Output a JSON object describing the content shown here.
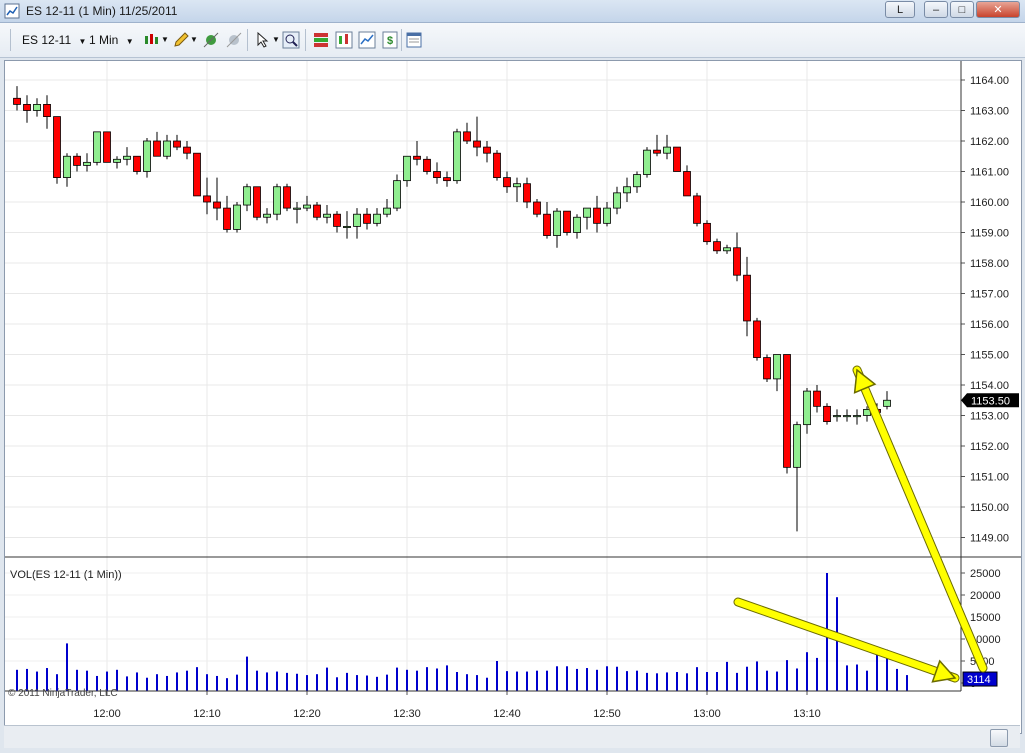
{
  "window": {
    "title": "ES 12-11 (1 Min)  11/25/2011",
    "link_button_label": "L",
    "minimize_label": "–",
    "maximize_label": "□",
    "close_label": "✕"
  },
  "toolbar": {
    "instrument": "ES 12-11",
    "interval": "1 Min",
    "icons": [
      "bar-style-icon",
      "pencil-icon",
      "indicator-icon",
      "strategy-icon",
      "cursor-icon",
      "zoom-icon",
      "chart-trader-icon",
      "candles-icon",
      "chart-properties-icon",
      "dollar-icon",
      "data-box-icon"
    ]
  },
  "chart_data": [
    {
      "type": "candlestick",
      "panel": "price",
      "x_ticks": [
        "12:00",
        "12:10",
        "12:20",
        "12:30",
        "12:40",
        "12:50",
        "13:00",
        "13:10"
      ],
      "y_ticks": [
        "1164.00",
        "1163.00",
        "1162.00",
        "1161.00",
        "1160.00",
        "1159.00",
        "1158.00",
        "1157.00",
        "1156.00",
        "1155.00",
        "1154.00",
        "1153.00",
        "1152.00",
        "1151.00",
        "1150.00",
        "1149.00"
      ],
      "ylim": [
        1148.5,
        1164.5
      ],
      "last_price_label": "1153.50",
      "up_color": "#90ee90",
      "down_color": "#ff0000",
      "candles": [
        [
          1163.4,
          1163.8,
          1163.0,
          1163.2
        ],
        [
          1163.2,
          1163.5,
          1162.6,
          1163.0
        ],
        [
          1163.0,
          1163.4,
          1162.8,
          1163.2
        ],
        [
          1163.2,
          1163.5,
          1162.4,
          1162.8
        ],
        [
          1162.8,
          1162.8,
          1160.6,
          1160.8
        ],
        [
          1160.8,
          1161.6,
          1160.5,
          1161.5
        ],
        [
          1161.5,
          1161.6,
          1161.0,
          1161.2
        ],
        [
          1161.2,
          1161.6,
          1161.0,
          1161.3
        ],
        [
          1161.3,
          1162.3,
          1161.2,
          1162.3
        ],
        [
          1162.3,
          1162.3,
          1161.3,
          1161.3
        ],
        [
          1161.3,
          1161.5,
          1161.1,
          1161.4
        ],
        [
          1161.4,
          1161.8,
          1161.2,
          1161.5
        ],
        [
          1161.5,
          1161.5,
          1160.9,
          1161.0
        ],
        [
          1161.0,
          1162.1,
          1160.8,
          1162.0
        ],
        [
          1162.0,
          1162.3,
          1161.5,
          1161.5
        ],
        [
          1161.5,
          1162.2,
          1161.4,
          1162.0
        ],
        [
          1162.0,
          1162.2,
          1161.7,
          1161.8
        ],
        [
          1161.8,
          1162.0,
          1161.4,
          1161.6
        ],
        [
          1161.6,
          1161.6,
          1160.2,
          1160.2
        ],
        [
          1160.2,
          1160.8,
          1159.6,
          1160.0
        ],
        [
          1160.0,
          1160.8,
          1159.4,
          1159.8
        ],
        [
          1159.8,
          1160.2,
          1159.0,
          1159.1
        ],
        [
          1159.1,
          1160.0,
          1159.0,
          1159.9
        ],
        [
          1159.9,
          1160.6,
          1159.7,
          1160.5
        ],
        [
          1160.5,
          1160.5,
          1159.4,
          1159.5
        ],
        [
          1159.5,
          1159.8,
          1159.3,
          1159.6
        ],
        [
          1159.6,
          1160.6,
          1159.4,
          1160.5
        ],
        [
          1160.5,
          1160.6,
          1159.7,
          1159.8
        ],
        [
          1159.8,
          1160.0,
          1159.3,
          1159.8
        ],
        [
          1159.8,
          1160.2,
          1159.7,
          1159.9
        ],
        [
          1159.9,
          1160.0,
          1159.4,
          1159.5
        ],
        [
          1159.5,
          1159.9,
          1159.3,
          1159.6
        ],
        [
          1159.6,
          1159.7,
          1159.0,
          1159.2
        ],
        [
          1159.2,
          1159.7,
          1158.8,
          1159.2
        ],
        [
          1159.2,
          1159.8,
          1158.8,
          1159.6
        ],
        [
          1159.6,
          1159.8,
          1159.1,
          1159.3
        ],
        [
          1159.3,
          1159.8,
          1159.2,
          1159.6
        ],
        [
          1159.6,
          1160.1,
          1159.5,
          1159.8
        ],
        [
          1159.8,
          1160.9,
          1159.7,
          1160.7
        ],
        [
          1160.7,
          1161.5,
          1160.5,
          1161.5
        ],
        [
          1161.5,
          1162.0,
          1161.2,
          1161.4
        ],
        [
          1161.4,
          1161.5,
          1160.9,
          1161.0
        ],
        [
          1161.0,
          1161.3,
          1160.6,
          1160.8
        ],
        [
          1160.8,
          1161.0,
          1160.5,
          1160.7
        ],
        [
          1160.7,
          1162.4,
          1160.6,
          1162.3
        ],
        [
          1162.3,
          1162.6,
          1161.9,
          1162.0
        ],
        [
          1162.0,
          1162.8,
          1161.5,
          1161.8
        ],
        [
          1161.8,
          1162.0,
          1161.3,
          1161.6
        ],
        [
          1161.6,
          1161.7,
          1160.7,
          1160.8
        ],
        [
          1160.8,
          1161.0,
          1160.3,
          1160.5
        ],
        [
          1160.5,
          1160.8,
          1160.0,
          1160.6
        ],
        [
          1160.6,
          1160.8,
          1159.8,
          1160.0
        ],
        [
          1160.0,
          1160.1,
          1159.5,
          1159.6
        ],
        [
          1159.6,
          1160.0,
          1158.8,
          1158.9
        ],
        [
          1158.9,
          1159.8,
          1158.5,
          1159.7
        ],
        [
          1159.7,
          1159.7,
          1158.9,
          1159.0
        ],
        [
          1159.0,
          1159.6,
          1158.8,
          1159.5
        ],
        [
          1159.5,
          1159.8,
          1159.1,
          1159.8
        ],
        [
          1159.8,
          1160.2,
          1159.0,
          1159.3
        ],
        [
          1159.3,
          1160.0,
          1159.2,
          1159.8
        ],
        [
          1159.8,
          1160.5,
          1159.6,
          1160.3
        ],
        [
          1160.3,
          1160.8,
          1160.0,
          1160.5
        ],
        [
          1160.5,
          1161.0,
          1160.3,
          1160.9
        ],
        [
          1160.9,
          1161.8,
          1160.8,
          1161.7
        ],
        [
          1161.7,
          1162.2,
          1161.5,
          1161.6
        ],
        [
          1161.6,
          1162.2,
          1161.4,
          1161.8
        ],
        [
          1161.8,
          1161.8,
          1161.0,
          1161.0
        ],
        [
          1161.0,
          1161.2,
          1160.2,
          1160.2
        ],
        [
          1160.2,
          1160.3,
          1159.2,
          1159.3
        ],
        [
          1159.3,
          1159.4,
          1158.6,
          1158.7
        ],
        [
          1158.7,
          1158.8,
          1158.3,
          1158.4
        ],
        [
          1158.4,
          1158.6,
          1158.3,
          1158.5
        ],
        [
          1158.5,
          1159.0,
          1157.4,
          1157.6
        ],
        [
          1157.6,
          1158.2,
          1155.6,
          1156.1
        ],
        [
          1156.1,
          1156.2,
          1154.8,
          1154.9
        ],
        [
          1154.9,
          1155.0,
          1154.1,
          1154.2
        ],
        [
          1154.2,
          1155.0,
          1153.8,
          1155.0
        ],
        [
          1155.0,
          1155.0,
          1151.1,
          1151.3
        ],
        [
          1151.3,
          1152.8,
          1149.2,
          1152.7
        ],
        [
          1152.7,
          1153.9,
          1152.4,
          1153.8
        ],
        [
          1153.8,
          1154.0,
          1153.1,
          1153.3
        ],
        [
          1153.3,
          1153.4,
          1152.7,
          1152.8
        ],
        [
          1153.0,
          1153.2,
          1152.8,
          1153.0
        ],
        [
          1153.0,
          1153.2,
          1152.8,
          1153.0
        ],
        [
          1153.0,
          1153.2,
          1152.7,
          1153.0
        ],
        [
          1153.0,
          1153.3,
          1152.8,
          1153.2
        ],
        [
          1153.2,
          1153.4,
          1152.9,
          1153.1
        ],
        [
          1153.3,
          1153.8,
          1153.2,
          1153.5
        ]
      ]
    },
    {
      "type": "bar",
      "panel": "volume",
      "label": "VOL(ES 12-11 (1 Min))",
      "y_ticks": [
        "25000",
        "20000",
        "15000",
        "10000",
        "5000",
        "0"
      ],
      "ylim": [
        0,
        26000
      ],
      "last_value_label": "3114",
      "color": "#0000cd",
      "values": [
        3000,
        3200,
        2600,
        3400,
        2000,
        9000,
        3000,
        2800,
        1600,
        2600,
        3000,
        1500,
        2400,
        1200,
        2000,
        1600,
        2400,
        2800,
        3600,
        2000,
        1600,
        1100,
        1900,
        6000,
        2800,
        2400,
        2600,
        2300,
        2100,
        1800,
        2000,
        3500,
        1300,
        2300,
        1800,
        1700,
        1400,
        1900,
        3500,
        3000,
        2800,
        3600,
        3300,
        4000,
        2500,
        2000,
        1800,
        1200,
        5000,
        2700,
        2600,
        2600,
        2800,
        2800,
        3800,
        3800,
        3200,
        3400,
        3000,
        3800,
        3700,
        2700,
        2800,
        2300,
        2200,
        2400,
        2500,
        2200,
        3600,
        2500,
        2500,
        4800,
        2300,
        3700,
        4900,
        2800,
        2600,
        5200,
        3300,
        7000,
        5700,
        25000,
        19500,
        4000,
        4200,
        2800,
        6500,
        7600,
        3200,
        1800
      ]
    }
  ],
  "annotations": {
    "copyright": "© 2011 NinjaTrader, LLC",
    "arrow_color": "#ffff00"
  }
}
